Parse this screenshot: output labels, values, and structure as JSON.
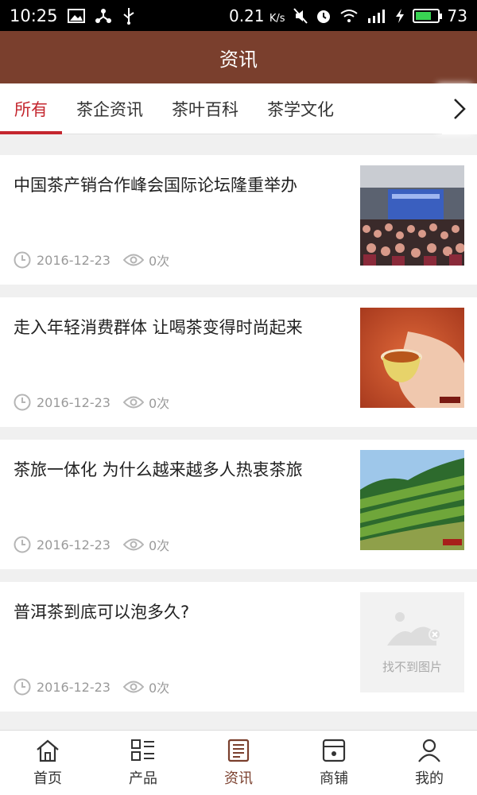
{
  "status_bar": {
    "time": "10:25",
    "speed": "0.21",
    "speed_unit": "K/s",
    "battery": "73",
    "battery_level_percent": 73
  },
  "header": {
    "title": "资讯"
  },
  "tabs": [
    {
      "label": "所有",
      "active": true
    },
    {
      "label": "茶企资讯",
      "active": false
    },
    {
      "label": "茶叶百科",
      "active": false
    },
    {
      "label": "茶学文化",
      "active": false
    }
  ],
  "news": [
    {
      "title": "中国茶产销合作峰会国际论坛隆重举办",
      "date": "2016-12-23",
      "views": "0次",
      "image": "conference-photo"
    },
    {
      "title": "走入年轻消费群体 让喝茶变得时尚起来",
      "date": "2016-12-23",
      "views": "0次",
      "image": "tea-cup-photo"
    },
    {
      "title": "茶旅一体化 为什么越来越多人热衷茶旅",
      "date": "2016-12-23",
      "views": "0次",
      "image": "tea-plantation-photo"
    },
    {
      "title": "普洱茶到底可以泡多久?",
      "date": "2016-12-23",
      "views": "0次",
      "image": "missing",
      "missing_text": "找不到图片"
    }
  ],
  "bottom_nav": [
    {
      "label": "首页",
      "icon": "home-icon",
      "active": false
    },
    {
      "label": "产品",
      "icon": "product-grid-icon",
      "active": false
    },
    {
      "label": "资讯",
      "icon": "news-icon",
      "active": true
    },
    {
      "label": "商铺",
      "icon": "shop-icon",
      "active": false
    },
    {
      "label": "我的",
      "icon": "user-icon",
      "active": false
    }
  ],
  "colors": {
    "brand": "#7a3f2d",
    "accent": "#c4262e"
  }
}
